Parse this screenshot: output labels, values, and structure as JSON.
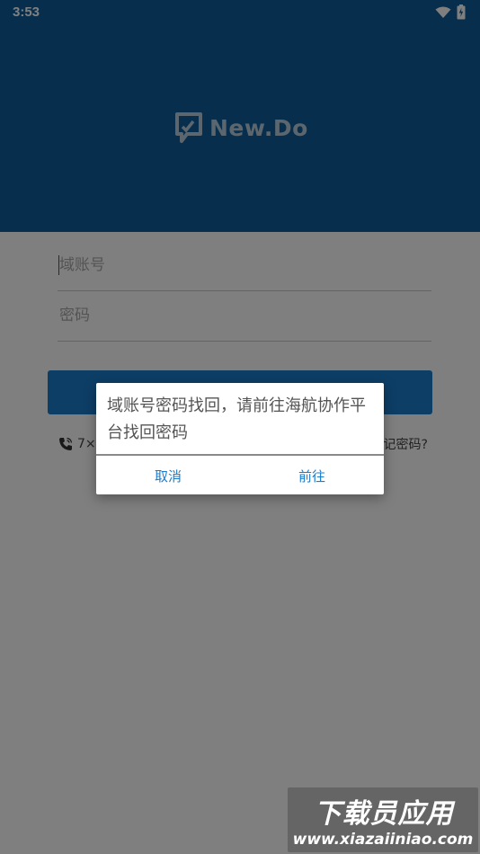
{
  "status_bar": {
    "time": "3:53"
  },
  "header": {
    "logo_text": "New.Do",
    "logo_color": "#b7cddd",
    "background": "#0e5d9a"
  },
  "login_form": {
    "username_placeholder": "域账号",
    "password_placeholder": "密码",
    "login_button_label": "",
    "hotline_text": "7×2",
    "forgot_password_text": "忘记密码?"
  },
  "dialog": {
    "message": "域账号密码找回，请前往海航协作平台找回密码",
    "cancel_label": "取消",
    "confirm_label": "前往",
    "accent_color": "#1a7ccc"
  },
  "watermark": {
    "title": "下载员应用",
    "url": "www.xiazaiiniao.com"
  }
}
